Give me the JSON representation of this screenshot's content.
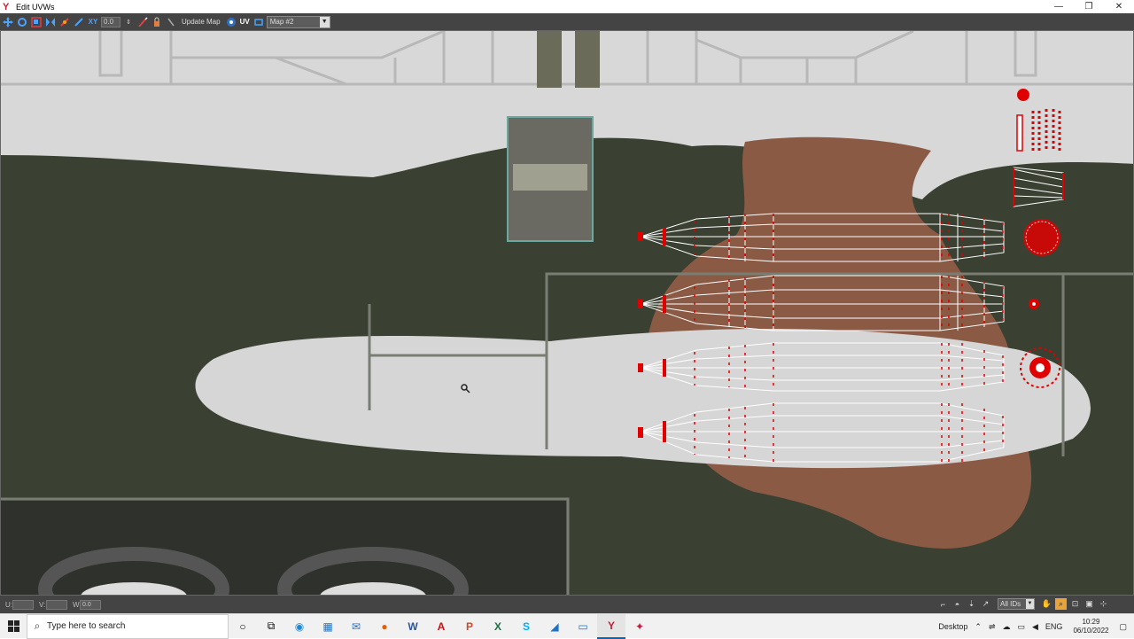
{
  "window": {
    "title": "Edit UVWs",
    "controls": {
      "minimize": "—",
      "restore": "❐",
      "close": "✕"
    }
  },
  "toolbar": {
    "spinner_value": "0.0",
    "update_map_label": "Update Map",
    "uv_label": "UV",
    "map_select_value": "Map #2"
  },
  "status": {
    "u_label": "U:",
    "v_label": "V:",
    "w_label": "W:",
    "w_value": "0.0",
    "ids_select_value": "All IDs"
  },
  "taskbar": {
    "search_placeholder": "Type here to search",
    "desktop_label": "Desktop",
    "lang": "ENG",
    "time": "10:29",
    "date": "06/10/2022"
  },
  "colors": {
    "uv_wire": "#e00000",
    "uv_edge": "#ffffff",
    "texture_dark": "#3a4132",
    "texture_light": "#d6d6d6",
    "texture_brown": "#8a5a45",
    "accent_blue": "#0067c0"
  }
}
